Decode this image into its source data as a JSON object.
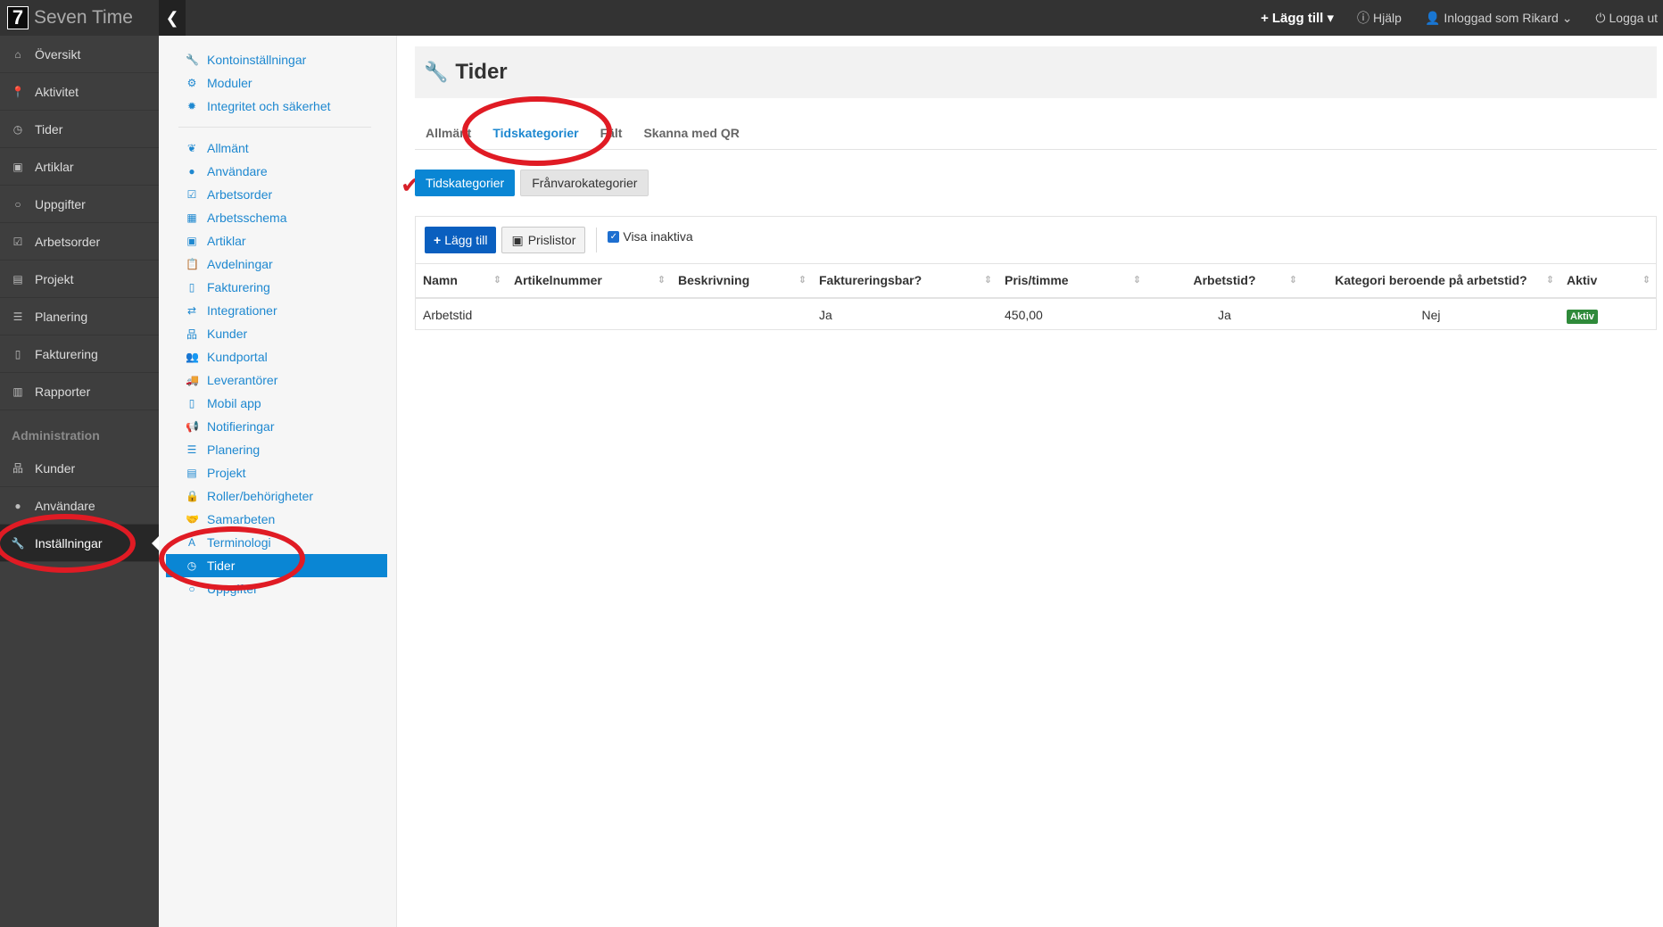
{
  "brand": {
    "logo": "7",
    "name": "Seven Time"
  },
  "topnav": {
    "add_label": "Lägg till",
    "help_label": "Hjälp",
    "logged_in_label": "Inloggad som Rikard",
    "logout_label": "Logga ut"
  },
  "sidebar": {
    "items": [
      {
        "label": "Översikt",
        "icon": "home-icon"
      },
      {
        "label": "Aktivitet",
        "icon": "map-marker-icon"
      },
      {
        "label": "Tider",
        "icon": "clock-icon"
      },
      {
        "label": "Artiklar",
        "icon": "money-icon"
      },
      {
        "label": "Uppgifter",
        "icon": "circle-icon"
      },
      {
        "label": "Arbetsorder",
        "icon": "checkbox-icon"
      },
      {
        "label": "Projekt",
        "icon": "briefcase-icon"
      },
      {
        "label": "Planering",
        "icon": "list-icon"
      },
      {
        "label": "Fakturering",
        "icon": "file-icon"
      },
      {
        "label": "Rapporter",
        "icon": "bar-chart-icon"
      }
    ],
    "section_label": "Administration",
    "admin_items": [
      {
        "label": "Kunder",
        "icon": "sitemap-icon"
      },
      {
        "label": "Användare",
        "icon": "user-icon"
      },
      {
        "label": "Inställningar",
        "icon": "wrench-icon"
      }
    ]
  },
  "submenu": {
    "group1": [
      {
        "label": "Kontoinställningar",
        "icon": "wrench-icon"
      },
      {
        "label": "Moduler",
        "icon": "cogs-icon"
      },
      {
        "label": "Integritet och säkerhet",
        "icon": "gear-icon"
      }
    ],
    "group2": [
      {
        "label": "Allmänt",
        "icon": "leaf-icon"
      },
      {
        "label": "Användare",
        "icon": "user-icon"
      },
      {
        "label": "Arbetsorder",
        "icon": "checkbox-icon"
      },
      {
        "label": "Arbetsschema",
        "icon": "calendar-icon"
      },
      {
        "label": "Artiklar",
        "icon": "money-icon"
      },
      {
        "label": "Avdelningar",
        "icon": "paste-icon"
      },
      {
        "label": "Fakturering",
        "icon": "file-icon"
      },
      {
        "label": "Integrationer",
        "icon": "exchange-icon"
      },
      {
        "label": "Kunder",
        "icon": "sitemap-icon"
      },
      {
        "label": "Kundportal",
        "icon": "users-icon"
      },
      {
        "label": "Leverantörer",
        "icon": "truck-icon"
      },
      {
        "label": "Mobil app",
        "icon": "mobile-icon"
      },
      {
        "label": "Notifieringar",
        "icon": "bullhorn-icon"
      },
      {
        "label": "Planering",
        "icon": "list-icon"
      },
      {
        "label": "Projekt",
        "icon": "briefcase-icon"
      },
      {
        "label": "Roller/behörigheter",
        "icon": "lock-icon"
      },
      {
        "label": "Samarbeten",
        "icon": "handshake-icon"
      },
      {
        "label": "Terminologi",
        "icon": "font-icon"
      },
      {
        "label": "Tider",
        "icon": "clock-icon"
      },
      {
        "label": "Uppgifter",
        "icon": "circle-icon"
      }
    ]
  },
  "page": {
    "title": "Tider",
    "tabs": [
      "Allmänt",
      "Tidskategorier",
      "Fält",
      "Skanna med QR"
    ],
    "pills": [
      "Tidskategorier",
      "Frånvarokategorier"
    ],
    "toolbar": {
      "add_label": "Lägg till",
      "pricelist_label": "Prislistor",
      "show_inactive_label": "Visa inaktiva"
    }
  },
  "table": {
    "headers": [
      "Namn",
      "Artikelnummer",
      "Beskrivning",
      "Faktureringsbar?",
      "Pris/timme",
      "Arbetstid?",
      "Kategori beroende på arbetstid?",
      "Aktiv"
    ],
    "rows": [
      {
        "name": "Arbetstid",
        "article": "",
        "description": "",
        "billable": "Ja",
        "price": "450,00",
        "worktime": "Ja",
        "dependent": "Nej",
        "active": "Aktiv"
      }
    ]
  },
  "colors": {
    "accent": "#0a86d4",
    "annotation": "#e01b24",
    "active_badge": "#2f8a3a"
  }
}
